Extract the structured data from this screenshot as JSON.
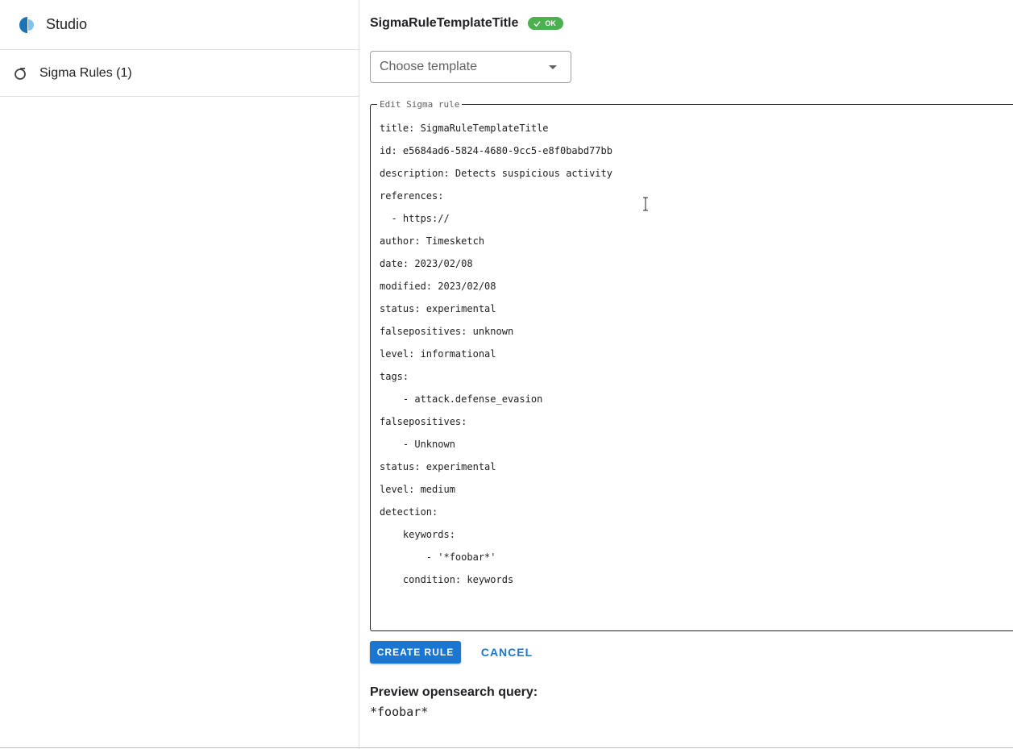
{
  "sidebar": {
    "brand": {
      "name": "Studio",
      "icon": "timesketch-logo"
    },
    "items": [
      {
        "label": "Sigma Rules (1)",
        "icon": "sigma-icon"
      }
    ]
  },
  "main": {
    "rule_title": "SigmaRuleTemplateTitle",
    "status_badge": "OK",
    "template_select": {
      "placeholder": "Choose template"
    },
    "editor": {
      "legend": "Edit Sigma rule",
      "lines": [
        "title: SigmaRuleTemplateTitle",
        "id: e5684ad6-5824-4680-9cc5-e8f0babd77bb",
        "description: Detects suspicious activity",
        "references:",
        "  - https://",
        "author: Timesketch",
        "date: 2023/02/08",
        "modified: 2023/02/08",
        "status: experimental",
        "falsepositives: unknown",
        "level: informational",
        "tags:",
        "    - attack.defense_evasion",
        "falsepositives:",
        "    - Unknown",
        "status: experimental",
        "level: medium",
        "detection:",
        "    keywords:",
        "        - '*foobar*'",
        "    condition: keywords"
      ]
    },
    "buttons": {
      "create": "CREATE RULE",
      "cancel": "CANCEL"
    },
    "preview": {
      "label": "Preview opensearch query:",
      "query": "*foobar*"
    }
  },
  "colors": {
    "primary": "#1976d2",
    "ok_green": "#4caf50",
    "logo_dark": "#1e73b8",
    "logo_light": "#7ec3ec"
  }
}
